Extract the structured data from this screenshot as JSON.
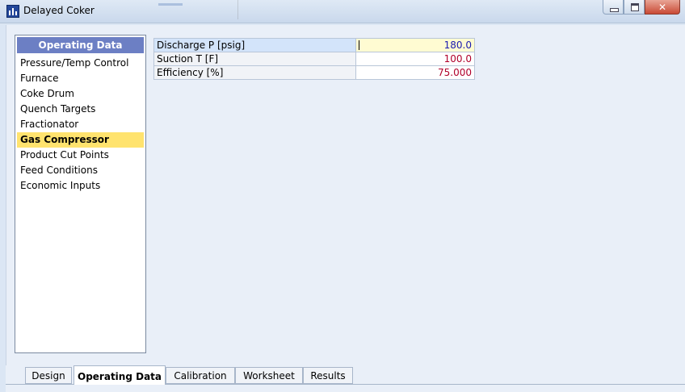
{
  "window": {
    "title": "Delayed Coker",
    "icon": "bar-chart-app-icon",
    "controls": {
      "minimize": "minimize-icon",
      "maximize": "maximize-icon",
      "close": "✕"
    }
  },
  "nav": {
    "header": "Operating Data",
    "items": [
      {
        "label": "Pressure/Temp Control",
        "selected": false
      },
      {
        "label": "Furnace",
        "selected": false
      },
      {
        "label": "Coke Drum",
        "selected": false
      },
      {
        "label": "Quench Targets",
        "selected": false
      },
      {
        "label": "Fractionator",
        "selected": false
      },
      {
        "label": "Gas Compressor",
        "selected": true
      },
      {
        "label": "Product Cut Points",
        "selected": false
      },
      {
        "label": "Feed Conditions",
        "selected": false
      },
      {
        "label": "Economic Inputs",
        "selected": false
      }
    ]
  },
  "properties": [
    {
      "label": "Discharge P [psig]",
      "value": "180.0",
      "value_color": "#1a1ab0"
    },
    {
      "label": "Suction T [F]",
      "value": "100.0",
      "value_color": "#b0002a"
    },
    {
      "label": "Efficiency [%]",
      "value": "75.000",
      "value_color": "#b0002a"
    }
  ],
  "tabs": [
    {
      "label": "Design",
      "active": false
    },
    {
      "label": "Operating Data",
      "active": true
    },
    {
      "label": "Calibration",
      "active": false
    },
    {
      "label": "Worksheet",
      "active": false
    },
    {
      "label": "Results",
      "active": false
    }
  ],
  "colors": {
    "nav_header_bg": "#6c7fc4",
    "selected_bg": "#ffe36e",
    "content_bg": "#e9eff8"
  }
}
